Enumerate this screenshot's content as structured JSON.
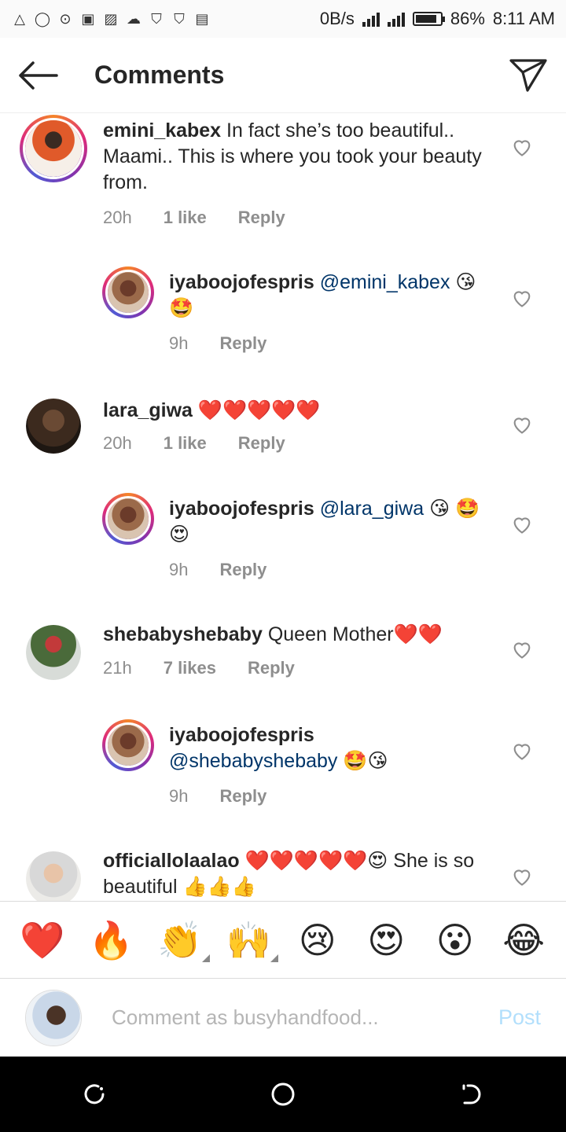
{
  "status_bar": {
    "speed": "0B/s",
    "battery": "86%",
    "battery_level": 0.86,
    "time": "8:11 AM",
    "icons": [
      "drive-icon",
      "whatsapp-icon",
      "opera-icon",
      "lock-icon",
      "image-icon",
      "cloud-upload-icon",
      "shield-icon",
      "shield-icon",
      "activity-icon"
    ]
  },
  "header": {
    "title": "Comments"
  },
  "comments": [
    {
      "username": "emini_kabex",
      "text": "In fact she’s too beautiful.. Maami.. This is where you took your beauty from.",
      "time": "20h",
      "likes": "1 like",
      "reply": "Reply"
    },
    {
      "username": "iyaboojofespris",
      "mention": "@emini_kabex",
      "text": "😘🤩",
      "time": "9h",
      "reply": "Reply"
    },
    {
      "username": "lara_giwa",
      "text": "❤️❤️❤️❤️❤️",
      "time": "20h",
      "likes": "1 like",
      "reply": "Reply"
    },
    {
      "username": "iyaboojofespris",
      "mention": "@lara_giwa",
      "text": "😘 🤩😍",
      "time": "9h",
      "reply": "Reply"
    },
    {
      "username": "shebabyshebaby",
      "text": "Queen Mother❤️❤️",
      "time": "21h",
      "likes": "7 likes",
      "reply": "Reply"
    },
    {
      "username": "iyaboojofespris",
      "mention": "@shebabyshebaby",
      "text": "🤩😘",
      "time": "9h",
      "reply": "Reply"
    },
    {
      "username": "officiallolaalao",
      "text": "❤️❤️❤️❤️❤️😍 She is so beautiful 👍👍👍"
    }
  ],
  "reactions": [
    "❤️",
    "🔥",
    "👏",
    "🙌",
    "😢",
    "😍",
    "😮",
    "😂"
  ],
  "composer": {
    "placeholder": "Comment as busyhandfood...",
    "post_label": "Post"
  }
}
